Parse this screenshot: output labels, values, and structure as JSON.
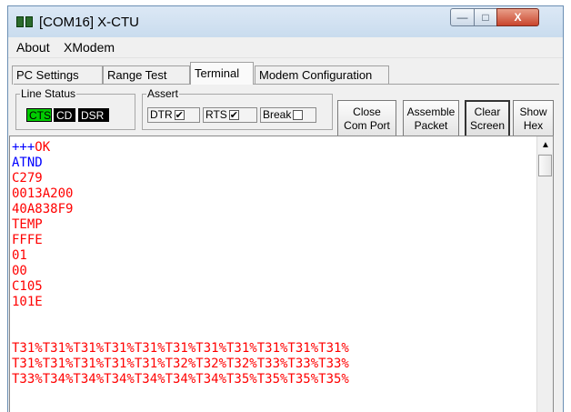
{
  "window": {
    "title": "[COM16] X-CTU"
  },
  "window_controls": {
    "minimize": "—",
    "maximize": "□",
    "close": "X"
  },
  "menu": {
    "items": [
      "About",
      "XModem"
    ]
  },
  "tabs": [
    {
      "label": "PC Settings",
      "active": false
    },
    {
      "label": "Range Test",
      "active": false
    },
    {
      "label": "Terminal",
      "active": true
    },
    {
      "label": "Modem Configuration",
      "active": false
    }
  ],
  "line_status": {
    "legend": "Line Status",
    "indicators": [
      {
        "label": "CTS",
        "color": "#00cc00"
      },
      {
        "label": "CD",
        "color": "#000000"
      },
      {
        "label": "DSR",
        "color": "#000000"
      }
    ]
  },
  "assert": {
    "legend": "Assert",
    "items": [
      {
        "label": "DTR",
        "checked": true
      },
      {
        "label": "RTS",
        "checked": true
      },
      {
        "label": "Break",
        "checked": false
      }
    ]
  },
  "buttons": {
    "close_com_port": [
      "Close",
      "Com Port"
    ],
    "assemble_packet": [
      "Assemble",
      "Packet"
    ],
    "clear_screen": [
      "Clear",
      "Screen"
    ],
    "show_hex": [
      "Show",
      "Hex"
    ]
  },
  "terminal": {
    "sent_color": "#0000ff",
    "received_color": "#ff0000",
    "lines": [
      {
        "text": "+++OK",
        "kind": "mixed"
      },
      {
        "text": "ATND",
        "kind": "sent"
      },
      {
        "text": "C279",
        "kind": "received"
      },
      {
        "text": "0013A200",
        "kind": "received"
      },
      {
        "text": "40A838F9",
        "kind": "received"
      },
      {
        "text": "TEMP",
        "kind": "received"
      },
      {
        "text": "FFFE",
        "kind": "received"
      },
      {
        "text": "01",
        "kind": "received"
      },
      {
        "text": "00",
        "kind": "received"
      },
      {
        "text": "C105",
        "kind": "received"
      },
      {
        "text": "101E",
        "kind": "received"
      },
      {
        "text": "",
        "kind": "received"
      },
      {
        "text": "",
        "kind": "received"
      },
      {
        "text": "T31%T31%T31%T31%T31%T31%T31%T31%T31%T31%T31%",
        "kind": "received"
      },
      {
        "text": "T31%T31%T31%T31%T31%T32%T32%T32%T33%T33%T33%",
        "kind": "received"
      },
      {
        "text": "T33%T34%T34%T34%T34%T34%T34%T35%T35%T35%T35%",
        "kind": "received"
      }
    ]
  }
}
